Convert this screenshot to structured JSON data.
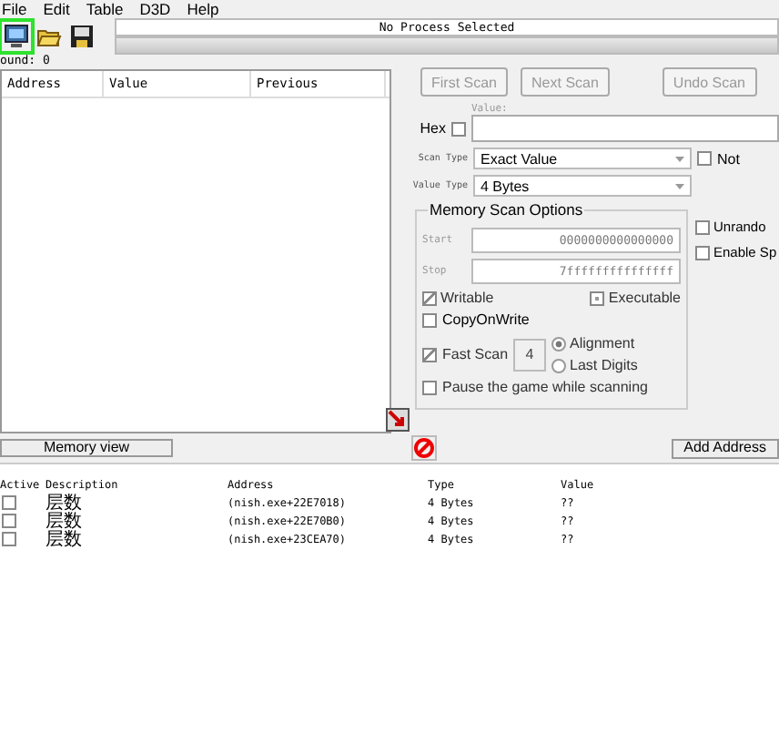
{
  "menu": [
    "File",
    "Edit",
    "Table",
    "D3D",
    "Help"
  ],
  "toolbar": {
    "process_title": "No Process Selected",
    "progress": {
      "level": 0
    }
  },
  "found_label": "ound: 0",
  "results": {
    "columns": [
      "Address",
      "Value",
      "Previous"
    ]
  },
  "scan_buttons": [
    {
      "label": "First Scan",
      "disabled": true
    },
    {
      "label": "Next Scan",
      "disabled": true
    },
    {
      "label": "Undo Scan",
      "disabled": true
    }
  ],
  "value_label": "Value:",
  "hex": {
    "label": "Hex",
    "checked": false
  },
  "scan_type": {
    "label": "Scan Type",
    "value": "Exact Value"
  },
  "not": {
    "label": "Not",
    "checked": false
  },
  "value_type": {
    "label": "Value Type",
    "value": "4 Bytes"
  },
  "memory_options": {
    "title": "Memory Scan Options",
    "start_label": "Start",
    "start": "0000000000000000",
    "stop_label": "Stop",
    "stop": "7fffffffffffffff",
    "flags": [
      {
        "label": "Writable",
        "kind": "tick",
        "checked": true
      },
      {
        "label": "Executable",
        "kind": "square",
        "checked": true
      }
    ],
    "copy_on_write": {
      "label": "CopyOnWrite",
      "checked": false
    },
    "fast_scan": {
      "label": "Fast Scan",
      "checked": true,
      "value": "4"
    },
    "alignment": [
      {
        "label": "Alignment",
        "selected": true
      },
      {
        "label": "Last Digits",
        "selected": false
      }
    ],
    "pause": {
      "label": "Pause the game while scanning",
      "checked": false
    }
  },
  "side_options": [
    {
      "label": "Unrando",
      "checked": false
    },
    {
      "label": "Enable Sp",
      "checked": false
    }
  ],
  "memory_view_button": "Memory view",
  "add_address_button": "Add Address",
  "table": {
    "columns": [
      "Active",
      "Description",
      "Address",
      "Type",
      "Value"
    ],
    "rows": [
      {
        "active": false,
        "description": "层数",
        "address": "(nish.exe+22E7018)",
        "type": "4 Bytes",
        "value": "??"
      },
      {
        "active": false,
        "description": "层数",
        "address": "(nish.exe+22E70B0)",
        "type": "4 Bytes",
        "value": "??"
      },
      {
        "active": false,
        "description": "层数",
        "address": "(nish.exe+23CEA70)",
        "type": "4 Bytes",
        "value": "??"
      }
    ]
  }
}
